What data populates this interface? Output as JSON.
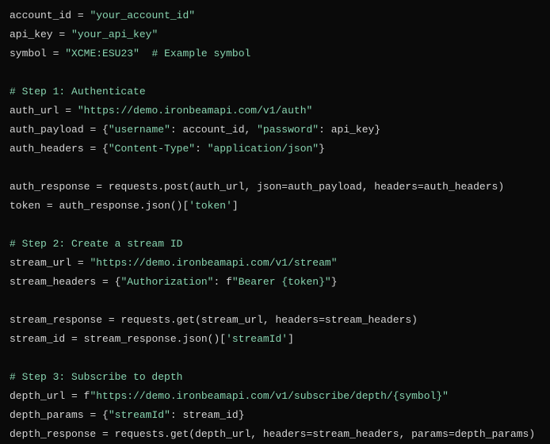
{
  "lines": [
    {
      "type": "code",
      "tokens": [
        {
          "t": "account_id",
          "c": "variable"
        },
        {
          "t": " ",
          "c": "variable"
        },
        {
          "t": "=",
          "c": "operator"
        },
        {
          "t": " ",
          "c": "variable"
        },
        {
          "t": "\"your_account_id\"",
          "c": "string"
        }
      ]
    },
    {
      "type": "code",
      "tokens": [
        {
          "t": "api_key",
          "c": "variable"
        },
        {
          "t": " ",
          "c": "variable"
        },
        {
          "t": "=",
          "c": "operator"
        },
        {
          "t": " ",
          "c": "variable"
        },
        {
          "t": "\"your_api_key\"",
          "c": "string"
        }
      ]
    },
    {
      "type": "code",
      "tokens": [
        {
          "t": "symbol",
          "c": "variable"
        },
        {
          "t": " ",
          "c": "variable"
        },
        {
          "t": "=",
          "c": "operator"
        },
        {
          "t": " ",
          "c": "variable"
        },
        {
          "t": "\"XCME:ESU23\"",
          "c": "string"
        },
        {
          "t": "  ",
          "c": "variable"
        },
        {
          "t": "# Example symbol",
          "c": "comment"
        }
      ]
    },
    {
      "type": "blank"
    },
    {
      "type": "code",
      "tokens": [
        {
          "t": "# Step 1: Authenticate",
          "c": "comment"
        }
      ]
    },
    {
      "type": "code",
      "tokens": [
        {
          "t": "auth_url",
          "c": "variable"
        },
        {
          "t": " ",
          "c": "variable"
        },
        {
          "t": "=",
          "c": "operator"
        },
        {
          "t": " ",
          "c": "variable"
        },
        {
          "t": "\"https://demo.ironbeamapi.com/v1/auth\"",
          "c": "string"
        }
      ]
    },
    {
      "type": "code",
      "tokens": [
        {
          "t": "auth_payload",
          "c": "variable"
        },
        {
          "t": " ",
          "c": "variable"
        },
        {
          "t": "=",
          "c": "operator"
        },
        {
          "t": " {",
          "c": "variable"
        },
        {
          "t": "\"username\"",
          "c": "string"
        },
        {
          "t": ": account_id, ",
          "c": "variable"
        },
        {
          "t": "\"password\"",
          "c": "string"
        },
        {
          "t": ": api_key}",
          "c": "variable"
        }
      ]
    },
    {
      "type": "code",
      "tokens": [
        {
          "t": "auth_headers",
          "c": "variable"
        },
        {
          "t": " ",
          "c": "variable"
        },
        {
          "t": "=",
          "c": "operator"
        },
        {
          "t": " {",
          "c": "variable"
        },
        {
          "t": "\"Content-Type\"",
          "c": "string"
        },
        {
          "t": ": ",
          "c": "variable"
        },
        {
          "t": "\"application/json\"",
          "c": "string"
        },
        {
          "t": "}",
          "c": "variable"
        }
      ]
    },
    {
      "type": "blank"
    },
    {
      "type": "code",
      "tokens": [
        {
          "t": "auth_response",
          "c": "variable"
        },
        {
          "t": " ",
          "c": "variable"
        },
        {
          "t": "=",
          "c": "operator"
        },
        {
          "t": " requests.post(auth_url, json=auth_payload, headers=auth_headers)",
          "c": "variable"
        }
      ]
    },
    {
      "type": "code",
      "tokens": [
        {
          "t": "token",
          "c": "variable"
        },
        {
          "t": " ",
          "c": "variable"
        },
        {
          "t": "=",
          "c": "operator"
        },
        {
          "t": " auth_response.json()[",
          "c": "variable"
        },
        {
          "t": "'token'",
          "c": "string"
        },
        {
          "t": "]",
          "c": "variable"
        }
      ]
    },
    {
      "type": "blank"
    },
    {
      "type": "code",
      "tokens": [
        {
          "t": "# Step 2: Create a stream ID",
          "c": "comment"
        }
      ]
    },
    {
      "type": "code",
      "tokens": [
        {
          "t": "stream_url",
          "c": "variable"
        },
        {
          "t": " ",
          "c": "variable"
        },
        {
          "t": "=",
          "c": "operator"
        },
        {
          "t": " ",
          "c": "variable"
        },
        {
          "t": "\"https://demo.ironbeamapi.com/v1/stream\"",
          "c": "string"
        }
      ]
    },
    {
      "type": "code",
      "tokens": [
        {
          "t": "stream_headers",
          "c": "variable"
        },
        {
          "t": " ",
          "c": "variable"
        },
        {
          "t": "=",
          "c": "operator"
        },
        {
          "t": " {",
          "c": "variable"
        },
        {
          "t": "\"Authorization\"",
          "c": "string"
        },
        {
          "t": ": f",
          "c": "variable"
        },
        {
          "t": "\"Bearer {token}\"",
          "c": "string"
        },
        {
          "t": "}",
          "c": "variable"
        }
      ]
    },
    {
      "type": "blank"
    },
    {
      "type": "code",
      "tokens": [
        {
          "t": "stream_response",
          "c": "variable"
        },
        {
          "t": " ",
          "c": "variable"
        },
        {
          "t": "=",
          "c": "operator"
        },
        {
          "t": " requests.get(stream_url, headers=stream_headers)",
          "c": "variable"
        }
      ]
    },
    {
      "type": "code",
      "tokens": [
        {
          "t": "stream_id",
          "c": "variable"
        },
        {
          "t": " ",
          "c": "variable"
        },
        {
          "t": "=",
          "c": "operator"
        },
        {
          "t": " stream_response.json()[",
          "c": "variable"
        },
        {
          "t": "'streamId'",
          "c": "string"
        },
        {
          "t": "]",
          "c": "variable"
        }
      ]
    },
    {
      "type": "blank"
    },
    {
      "type": "code",
      "tokens": [
        {
          "t": "# Step 3: Subscribe to depth",
          "c": "comment"
        }
      ]
    },
    {
      "type": "code",
      "tokens": [
        {
          "t": "depth_url",
          "c": "variable"
        },
        {
          "t": " ",
          "c": "variable"
        },
        {
          "t": "=",
          "c": "operator"
        },
        {
          "t": " f",
          "c": "variable"
        },
        {
          "t": "\"https://demo.ironbeamapi.com/v1/subscribe/depth/{symbol}\"",
          "c": "string"
        }
      ]
    },
    {
      "type": "code",
      "tokens": [
        {
          "t": "depth_params",
          "c": "variable"
        },
        {
          "t": " ",
          "c": "variable"
        },
        {
          "t": "=",
          "c": "operator"
        },
        {
          "t": " {",
          "c": "variable"
        },
        {
          "t": "\"streamId\"",
          "c": "string"
        },
        {
          "t": ": stream_id}",
          "c": "variable"
        }
      ]
    },
    {
      "type": "code",
      "tokens": [
        {
          "t": "depth_response",
          "c": "variable"
        },
        {
          "t": " ",
          "c": "variable"
        },
        {
          "t": "=",
          "c": "operator"
        },
        {
          "t": " requests.get(depth_url, headers=stream_headers, params=depth_params)",
          "c": "variable"
        }
      ]
    }
  ]
}
